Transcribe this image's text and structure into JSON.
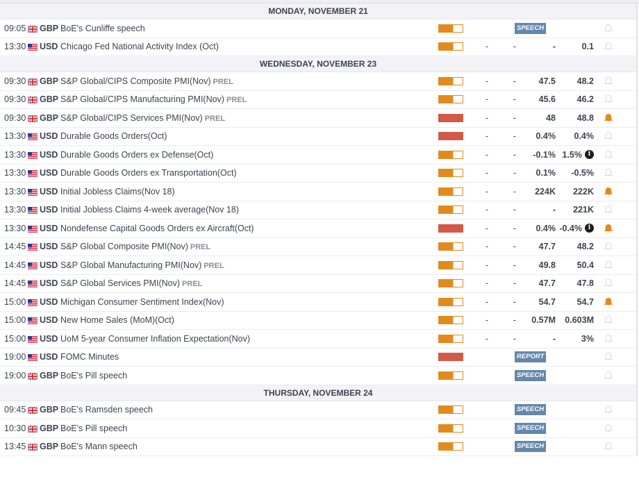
{
  "colors": {
    "medium": "#e38a1e",
    "high": "#d35a48",
    "badge": "#6487ab",
    "bell_on": "#e38a1e",
    "bell_off": "#d8d8dc"
  },
  "days": [
    {
      "label": "MONDAY, NOVEMBER 21",
      "rows": [
        {
          "time": "09:05",
          "cur": "GBP",
          "event": "BoE's Cunliffe speech",
          "impact": "medium",
          "badge": "SPEECH",
          "alert": false
        },
        {
          "time": "13:30",
          "cur": "USD",
          "event": "Chicago Fed National Activity Index (Oct)",
          "impact": "medium",
          "actual": "-",
          "consensus": "-",
          "forecast": "-",
          "previous": "0.1",
          "alert": false
        }
      ]
    },
    {
      "label": "WEDNESDAY, NOVEMBER 23",
      "rows": [
        {
          "time": "09:30",
          "cur": "GBP",
          "event": "S&P Global/CIPS Composite PMI(Nov)",
          "prel": "PREL",
          "impact": "medium",
          "actual": "-",
          "consensus": "-",
          "forecast": "47.5",
          "previous": "48.2",
          "alert": false
        },
        {
          "time": "09:30",
          "cur": "GBP",
          "event": "S&P Global/CIPS Manufacturing PMI(Nov)",
          "prel": "PREL",
          "impact": "medium",
          "actual": "-",
          "consensus": "-",
          "forecast": "45.6",
          "previous": "46.2",
          "alert": false
        },
        {
          "time": "09:30",
          "cur": "GBP",
          "event": "S&P Global/CIPS Services PMI(Nov)",
          "prel": "PREL",
          "impact": "high",
          "actual": "-",
          "consensus": "-",
          "forecast": "48",
          "previous": "48.8",
          "alert": true
        },
        {
          "time": "13:30",
          "cur": "USD",
          "event": "Durable Goods Orders(Oct)",
          "impact": "high",
          "actual": "-",
          "consensus": "-",
          "forecast": "0.4%",
          "previous": "0.4%",
          "alert": false
        },
        {
          "time": "13:30",
          "cur": "USD",
          "event": "Durable Goods Orders ex Defense(Oct)",
          "impact": "medium",
          "actual": "-",
          "consensus": "-",
          "forecast": "-0.1%",
          "previous": "1.5%",
          "info": true,
          "alert": false
        },
        {
          "time": "13:30",
          "cur": "USD",
          "event": "Durable Goods Orders ex Transportation(Oct)",
          "impact": "medium",
          "actual": "-",
          "consensus": "-",
          "forecast": "0.1%",
          "previous": "-0.5%",
          "alert": false
        },
        {
          "time": "13:30",
          "cur": "USD",
          "event": "Initial Jobless Claims(Nov 18)",
          "impact": "medium",
          "actual": "-",
          "consensus": "-",
          "forecast": "224K",
          "previous": "222K",
          "alert": true
        },
        {
          "time": "13:30",
          "cur": "USD",
          "event": "Initial Jobless Claims 4-week average(Nov 18)",
          "impact": "medium",
          "actual": "-",
          "consensus": "-",
          "forecast": "-",
          "previous": "221K",
          "alert": false
        },
        {
          "time": "13:30",
          "cur": "USD",
          "event": "Nondefense Capital Goods Orders ex Aircraft(Oct)",
          "impact": "high",
          "actual": "-",
          "consensus": "-",
          "forecast": "0.4%",
          "previous": "-0.4%",
          "info": true,
          "alert": true
        },
        {
          "time": "14:45",
          "cur": "USD",
          "event": "S&P Global Composite PMI(Nov)",
          "prel": "PREL",
          "impact": "medium",
          "actual": "-",
          "consensus": "-",
          "forecast": "47.7",
          "previous": "48.2",
          "alert": false
        },
        {
          "time": "14:45",
          "cur": "USD",
          "event": "S&P Global Manufacturing PMI(Nov)",
          "prel": "PREL",
          "impact": "medium",
          "actual": "-",
          "consensus": "-",
          "forecast": "49.8",
          "previous": "50.4",
          "alert": false
        },
        {
          "time": "14:45",
          "cur": "USD",
          "event": "S&P Global Services PMI(Nov)",
          "prel": "PREL",
          "impact": "medium",
          "actual": "-",
          "consensus": "-",
          "forecast": "47.7",
          "previous": "47.8",
          "alert": false
        },
        {
          "time": "15:00",
          "cur": "USD",
          "event": "Michigan Consumer Sentiment Index(Nov)",
          "impact": "medium",
          "actual": "-",
          "consensus": "-",
          "forecast": "54.7",
          "previous": "54.7",
          "alert": true
        },
        {
          "time": "15:00",
          "cur": "USD",
          "event": "New Home Sales (MoM)(Oct)",
          "impact": "medium",
          "actual": "-",
          "consensus": "-",
          "forecast": "0.57M",
          "previous": "0.603M",
          "alert": false
        },
        {
          "time": "15:00",
          "cur": "USD",
          "event": "UoM 5-year Consumer Inflation Expectation(Nov)",
          "impact": "medium",
          "actual": "-",
          "consensus": "-",
          "forecast": "-",
          "previous": "3%",
          "alert": false
        },
        {
          "time": "19:00",
          "cur": "USD",
          "event": "FOMC Minutes",
          "impact": "high",
          "badge": "REPORT",
          "alert": false
        },
        {
          "time": "19:00",
          "cur": "GBP",
          "event": "BoE's Pill speech",
          "impact": "medium",
          "badge": "SPEECH",
          "alert": false
        }
      ]
    },
    {
      "label": "THURSDAY, NOVEMBER 24",
      "rows": [
        {
          "time": "09:45",
          "cur": "GBP",
          "event": "BoE's Ramsden speech",
          "impact": "medium",
          "badge": "SPEECH",
          "alert": false
        },
        {
          "time": "10:30",
          "cur": "GBP",
          "event": "BoE's Pill speech",
          "impact": "medium",
          "badge": "SPEECH",
          "alert": false
        },
        {
          "time": "13:45",
          "cur": "GBP",
          "event": "BoE's Mann speech",
          "impact": "medium",
          "badge": "SPEECH",
          "alert": false
        }
      ]
    }
  ]
}
